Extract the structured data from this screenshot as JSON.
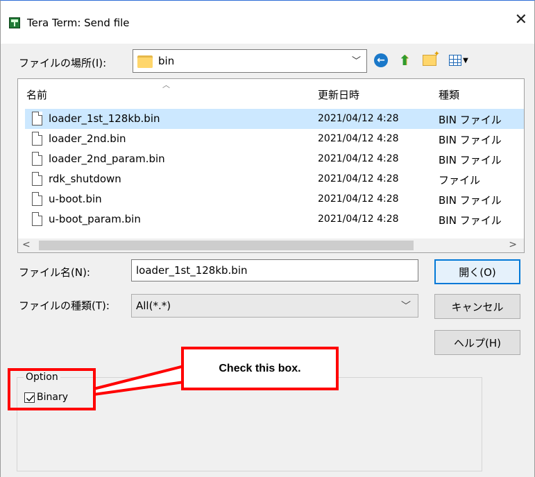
{
  "window": {
    "title": "Tera Term: Send file",
    "close_glyph": "✕"
  },
  "location": {
    "label": "ファイルの場所(I):",
    "value": "bin"
  },
  "toolbar": {
    "icons": [
      "back-icon",
      "up-folder-icon",
      "new-folder-icon",
      "view-menu-icon"
    ]
  },
  "file_list": {
    "headers": {
      "name": "名前",
      "date": "更新日時",
      "type": "種類"
    },
    "rows": [
      {
        "name": "loader_1st_128kb.bin",
        "date": "2021/04/12 4:28",
        "type": "BIN ファイル"
      },
      {
        "name": "loader_2nd.bin",
        "date": "2021/04/12 4:28",
        "type": "BIN ファイル"
      },
      {
        "name": "loader_2nd_param.bin",
        "date": "2021/04/12 4:28",
        "type": "BIN ファイル"
      },
      {
        "name": "rdk_shutdown",
        "date": "2021/04/12 4:28",
        "type": "ファイル"
      },
      {
        "name": "u-boot.bin",
        "date": "2021/04/12 4:28",
        "type": "BIN ファイル"
      },
      {
        "name": "u-boot_param.bin",
        "date": "2021/04/12 4:28",
        "type": "BIN ファイル"
      }
    ],
    "selected_index": 0
  },
  "filename": {
    "label": "ファイル名(N):",
    "value": "loader_1st_128kb.bin"
  },
  "filetype": {
    "label": "ファイルの種類(T):",
    "value": "All(*.*)"
  },
  "buttons": {
    "open": "開く(O)",
    "cancel": "キャンセル",
    "help": "ヘルプ(H)"
  },
  "option": {
    "group_label": "Option",
    "binary_label": "Binary",
    "binary_checked": true
  },
  "annotation": {
    "callout_text": "Check this box.",
    "highlight_color": "#ff0000"
  }
}
